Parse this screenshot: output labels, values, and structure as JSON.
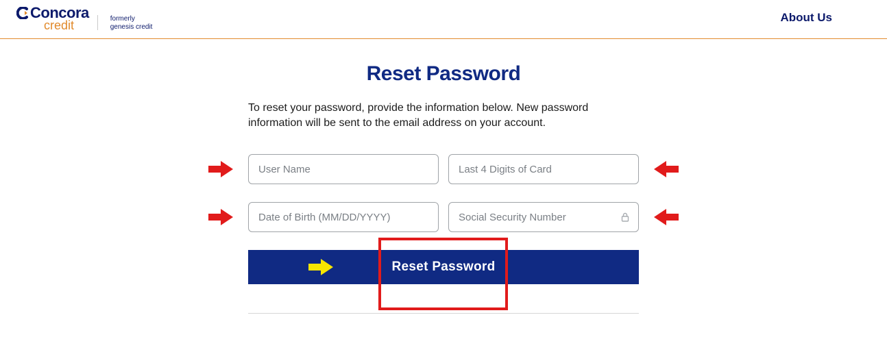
{
  "brand": {
    "name": "Concora",
    "subname": "credit",
    "tagline_line1": "formerly",
    "tagline_line2": "genesis credit"
  },
  "nav": {
    "about": "About Us"
  },
  "title": "Reset Password",
  "intro": "To reset your password, provide the information below. New password information will be sent to the email address on your account.",
  "fields": {
    "username_ph": "User Name",
    "last4_ph": "Last 4 Digits of Card",
    "dob_ph": "Date of Birth (MM/DD/YYYY)",
    "ssn_ph": "Social Security Number"
  },
  "submit_label": "Reset Password",
  "colors": {
    "accent": "#102a83",
    "rule": "#e38b2d",
    "highlight": "#e11b1b"
  }
}
